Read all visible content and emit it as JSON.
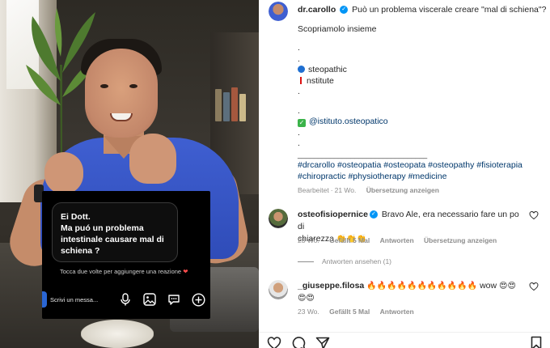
{
  "post": {
    "author": "dr.carollo",
    "caption_title": "Può un problema viscerale creare \"mal di schiena\"?",
    "caption_sub": "Scopriamolo insieme",
    "dot1": ".",
    "dot2": ".",
    "osteo_line1": "steopathic",
    "osteo_line2": "nstitute",
    "dot3": ".",
    "dot4": ".",
    "mention": "@istituto.osteopatico",
    "dot5": ".",
    "dot6": ".",
    "separator": "________________________________",
    "hashtags_line1": "#drcarollo #osteopatia #osteopata #osteopathy #fisioterapia",
    "hashtags_line2": "#chiropractic #physiotherapy #medicine",
    "edited": "Bearbeitet",
    "age": "21 Wo.",
    "translate": "Übersetzung anzeigen"
  },
  "story": {
    "question_l1": "Ei Dott.",
    "question_l2": "Ma puó un problema",
    "question_l3": "intestinale causare mal di",
    "question_l4": "schiena ?",
    "hint": "Tocca due volte per aggiungere una reazione",
    "reply_placeholder": "Scrivi un messa..."
  },
  "comments": [
    {
      "user": "osteofisiopernice",
      "text_l1": "Bravo Ale, era necessario fare un po di",
      "text_l2": "chiarezza",
      "emojis": "👏👏👏",
      "age": "23 Wo.",
      "likes": "Gefällt 5 Mal",
      "reply": "Antworten",
      "translate": "Übersetzung anzeigen"
    },
    {
      "user": "_giuseppe.filosa",
      "flames": "🔥🔥🔥🔥🔥🔥🔥🔥🔥🔥🔥",
      "word": "wow",
      "hearts1": "😍😍",
      "hearts2": "😍😍",
      "age": "23 Wo.",
      "likes": "Gefällt 5 Mal",
      "reply": "Antworten"
    }
  ],
  "view_replies": "Antworten ansehen (1)",
  "icons": {
    "like": "heart-icon",
    "comment": "comment-icon",
    "share": "paper-plane-icon",
    "save": "bookmark-icon",
    "mic": "microphone-icon",
    "gallery": "image-icon",
    "sticker": "chat-bubble-icon",
    "add": "plus-circle-icon"
  },
  "colors": {
    "accent": "#0095f6",
    "link": "#00376b",
    "muted": "#8e8e8e",
    "shirt": "#3f5fd1"
  }
}
